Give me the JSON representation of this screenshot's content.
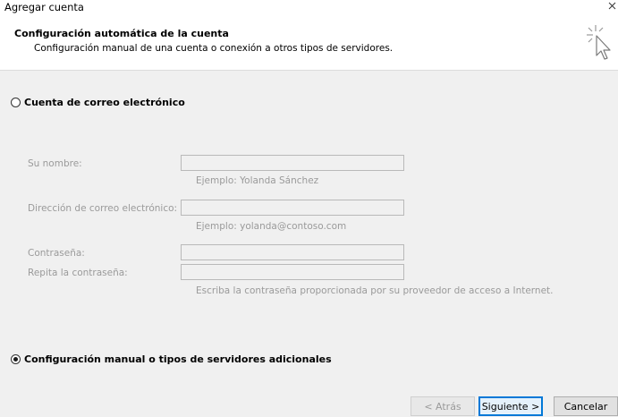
{
  "window": {
    "title": "Agregar cuenta"
  },
  "header": {
    "title": "Configuración automática de la cuenta",
    "subtitle": "Configuración manual de una cuenta o conexión a otros tipos de servidores."
  },
  "options": {
    "email_account": {
      "label": "Cuenta de correo electrónico",
      "selected": false
    },
    "manual_config": {
      "label": "Configuración manual o tipos de servidores adicionales",
      "selected": true
    }
  },
  "form": {
    "name": {
      "label": "Su nombre:",
      "value": "",
      "hint": "Ejemplo: Yolanda Sánchez"
    },
    "email": {
      "label": "Dirección de correo electrónico:",
      "value": "",
      "hint": "Ejemplo: yolanda@contoso.com"
    },
    "password": {
      "label": "Contraseña:",
      "value": ""
    },
    "password_repeat": {
      "label": "Repita la contraseña:",
      "value": "",
      "hint": "Escriba la contraseña proporcionada por su proveedor de acceso a Internet."
    }
  },
  "buttons": {
    "back": "< Atrás",
    "next": "Siguiente >",
    "cancel": "Cancelar"
  }
}
